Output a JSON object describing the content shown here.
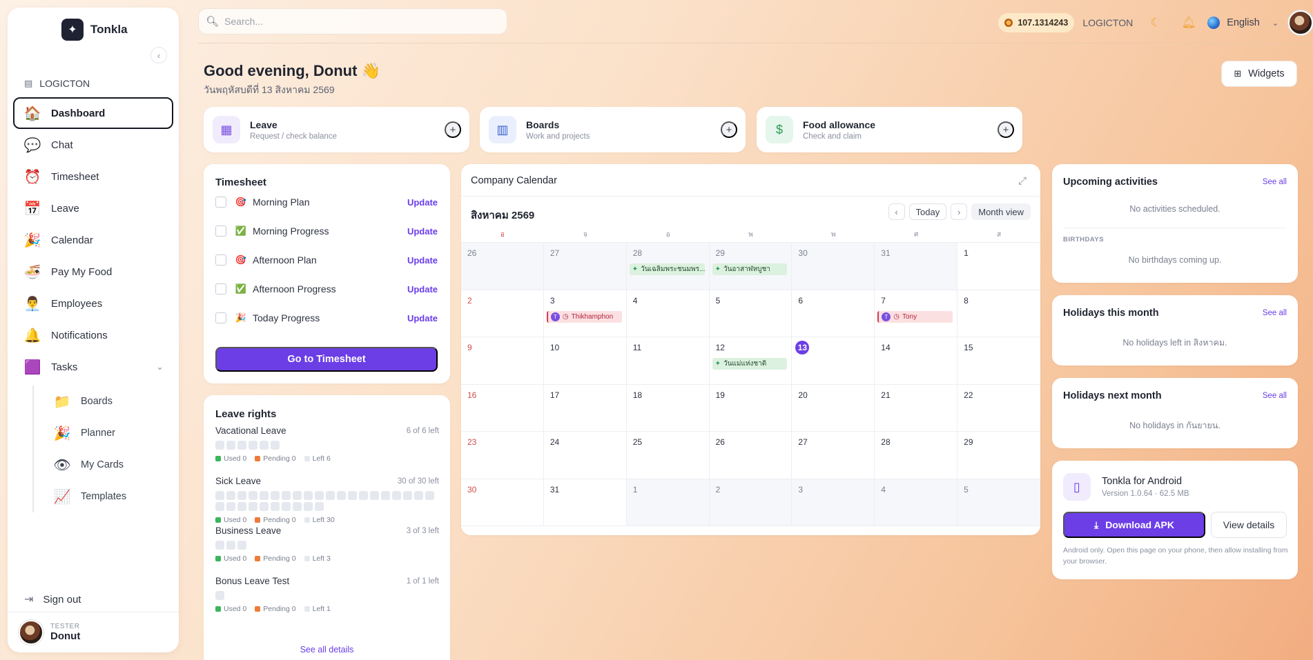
{
  "brand": {
    "name": "Tonkla",
    "collapse_icon": "chevron-left-icon"
  },
  "org": {
    "name": "LOGICTON"
  },
  "nav": {
    "items": [
      {
        "label": "Dashboard",
        "icon": "house-icon",
        "emoji": "🏠"
      },
      {
        "label": "Chat",
        "icon": "chat-icon",
        "emoji": "💬"
      },
      {
        "label": "Timesheet",
        "icon": "alarm-clock-icon",
        "emoji": "⏰"
      },
      {
        "label": "Leave",
        "icon": "calendar-icon",
        "emoji": "📅"
      },
      {
        "label": "Calendar",
        "icon": "party-icon",
        "emoji": "🎉"
      },
      {
        "label": "Pay My Food",
        "icon": "noodle-bowl-icon",
        "emoji": "🍜"
      },
      {
        "label": "Employees",
        "icon": "person-icon",
        "emoji": "👨‍💼"
      },
      {
        "label": "Notifications",
        "icon": "bell-icon",
        "emoji": "🔔"
      },
      {
        "label": "Tasks",
        "icon": "grid-icon",
        "emoji": "🟪"
      }
    ],
    "sub_items": [
      {
        "label": "Boards",
        "icon": "folder-icon",
        "emoji": "📁"
      },
      {
        "label": "Planner",
        "icon": "party-icon",
        "emoji": "🎉"
      },
      {
        "label": "My Cards",
        "icon": "eye-icon",
        "emoji": "👁"
      },
      {
        "label": "Templates",
        "icon": "chart-icon",
        "emoji": "📈"
      }
    ],
    "signout": "Sign out"
  },
  "user": {
    "role": "TESTER",
    "name": "Donut"
  },
  "topbar": {
    "search_placeholder": "Search...",
    "coins": "107.1314243",
    "org": "LOGICTON",
    "language": "English"
  },
  "greeting": {
    "title": "Good evening, Donut 👋",
    "date": "วันพฤหัสบดีที่ 13 สิงหาคม 2569",
    "widgets_label": "Widgets"
  },
  "quick": [
    {
      "title": "Leave",
      "sub": "Request / check balance",
      "icon": "calendar-icon",
      "glyph": "▦",
      "bg": "#f1ecfc",
      "fg": "#7a4fe0"
    },
    {
      "title": "Boards",
      "sub": "Work and projects",
      "icon": "columns-icon",
      "glyph": "▥",
      "bg": "#e9effc",
      "fg": "#3b5fd1"
    },
    {
      "title": "Food allowance",
      "sub": "Check and claim",
      "icon": "dollar-icon",
      "glyph": "$",
      "bg": "#e5f6ec",
      "fg": "#2c9a55"
    }
  ],
  "timesheet": {
    "title": "Timesheet",
    "rows": [
      {
        "label": "Morning Plan",
        "emoji": "🎯",
        "action": "Update"
      },
      {
        "label": "Morning Progress",
        "emoji": "✅",
        "action": "Update"
      },
      {
        "label": "Afternoon Plan",
        "emoji": "🎯",
        "action": "Update"
      },
      {
        "label": "Afternoon Progress",
        "emoji": "✅",
        "action": "Update"
      },
      {
        "label": "Today Progress",
        "emoji": "🎉",
        "action": "Update"
      }
    ],
    "goto": "Go to Timesheet"
  },
  "leave": {
    "title": "Leave rights",
    "types": [
      {
        "name": "Vacational Leave",
        "count": "6 of 6 left",
        "total": 6,
        "used": "Used 0",
        "pending": "Pending 0",
        "left": "Left 6"
      },
      {
        "name": "Sick Leave",
        "count": "30 of 30 left",
        "total": 30,
        "used": "Used 0",
        "pending": "Pending 0",
        "left": "Left 30"
      },
      {
        "name": "Business Leave",
        "count": "3 of 3 left",
        "total": 3,
        "used": "Used 0",
        "pending": "Pending 0",
        "left": "Left 3"
      },
      {
        "name": "Bonus Leave Test",
        "count": "1 of 1 left",
        "total": 1,
        "used": "Used 0",
        "pending": "Pending 0",
        "left": "Left 1"
      }
    ],
    "see_all": "See all details",
    "colors": {
      "used": "#3bb55e",
      "pending": "#ef7b3a",
      "left": "#e5e8ef"
    }
  },
  "calendar": {
    "title": "Company Calendar",
    "month": "สิงหาคม 2569",
    "today_label": "Today",
    "view_label": "Month view",
    "dow": [
      "อ",
      "จ",
      "อ",
      "พ",
      "พ",
      "ศ",
      "ส"
    ],
    "weeks": [
      [
        {
          "d": "26",
          "out": true
        },
        {
          "d": "27",
          "out": true
        },
        {
          "d": "28",
          "out": true,
          "ev": {
            "type": "hol",
            "text": "วันเฉลิมพระชนมพร..."
          }
        },
        {
          "d": "29",
          "out": true,
          "ev": {
            "type": "hol",
            "text": "วันอาสาฬหบูชา"
          }
        },
        {
          "d": "30",
          "out": true
        },
        {
          "d": "31",
          "out": true
        },
        {
          "d": "1"
        }
      ],
      [
        {
          "d": "2"
        },
        {
          "d": "3",
          "ev": {
            "type": "bday",
            "text": "Thikhamphon"
          }
        },
        {
          "d": "4"
        },
        {
          "d": "5"
        },
        {
          "d": "6"
        },
        {
          "d": "7",
          "ev": {
            "type": "bday",
            "text": "Tony"
          }
        },
        {
          "d": "8"
        }
      ],
      [
        {
          "d": "9"
        },
        {
          "d": "10"
        },
        {
          "d": "11"
        },
        {
          "d": "12",
          "ev": {
            "type": "hol",
            "text": "วันแม่แห่งชาติ"
          }
        },
        {
          "d": "13",
          "today": true
        },
        {
          "d": "14"
        },
        {
          "d": "15"
        }
      ],
      [
        {
          "d": "16"
        },
        {
          "d": "17"
        },
        {
          "d": "18"
        },
        {
          "d": "19"
        },
        {
          "d": "20"
        },
        {
          "d": "21"
        },
        {
          "d": "22"
        }
      ],
      [
        {
          "d": "23"
        },
        {
          "d": "24"
        },
        {
          "d": "25"
        },
        {
          "d": "26"
        },
        {
          "d": "27"
        },
        {
          "d": "28"
        },
        {
          "d": "29"
        }
      ],
      [
        {
          "d": "30"
        },
        {
          "d": "31"
        },
        {
          "d": "1",
          "out": true
        },
        {
          "d": "2",
          "out": true
        },
        {
          "d": "3",
          "out": true
        },
        {
          "d": "4",
          "out": true
        },
        {
          "d": "5",
          "out": true
        }
      ]
    ]
  },
  "upcoming": {
    "title": "Upcoming activities",
    "see_all": "See all",
    "empty": "No activities scheduled.",
    "bday_label": "BIRTHDAYS",
    "bday_empty": "No birthdays coming up."
  },
  "holidays_this": {
    "title": "Holidays this month",
    "see_all": "See all",
    "empty": "No holidays left in สิงหาคม."
  },
  "holidays_next": {
    "title": "Holidays next month",
    "see_all": "See all",
    "empty": "No holidays in กันยายน."
  },
  "android": {
    "title": "Tonkla for Android",
    "version": "Version 1.0.64 · 62.5 MB",
    "download": "Download APK",
    "details": "View details",
    "note": "Android only. Open this page on your phone, then allow installing from your browser."
  }
}
